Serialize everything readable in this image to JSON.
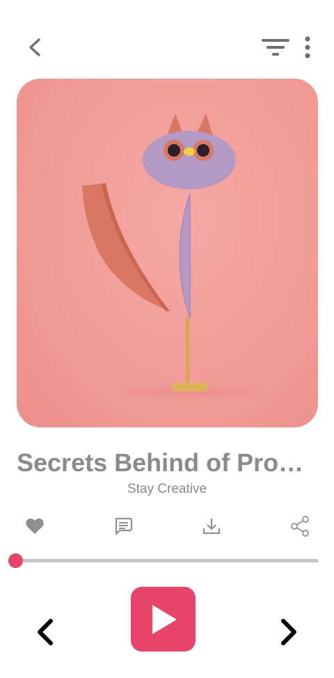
{
  "header": {
    "back_icon": "chevron-left-icon",
    "filter_icon": "filter-icon",
    "more_icon": "more-vertical-icon"
  },
  "artwork": {
    "description_icon": "album-art"
  },
  "track": {
    "title": "Secrets Behind of Productivity",
    "artist": "Stay Creative"
  },
  "actions": [
    {
      "name": "like",
      "icon": "heart-icon"
    },
    {
      "name": "comment",
      "icon": "comment-icon"
    },
    {
      "name": "download",
      "icon": "download-icon"
    },
    {
      "name": "share",
      "icon": "share-icon"
    }
  ],
  "player": {
    "progress": 0,
    "accent_color": "#e8446a",
    "track_color": "#c4c4c4",
    "text_color": "#8a8a8a"
  }
}
